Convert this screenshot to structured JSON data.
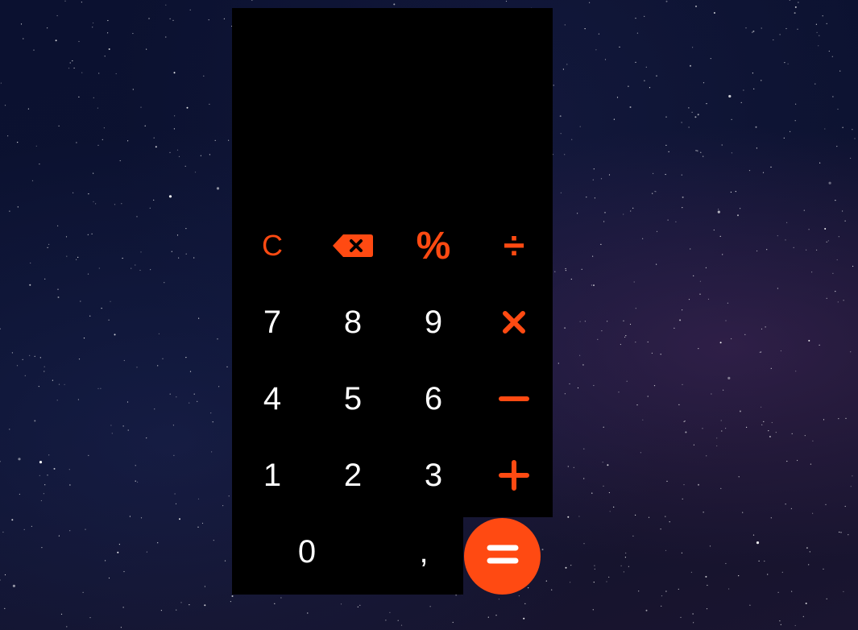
{
  "colors": {
    "accent": "#ff4a12",
    "digit": "#ffffff",
    "panel": "#000000"
  },
  "display": {
    "value": ""
  },
  "keys": {
    "clear": "C",
    "backspace_icon": "backspace-icon",
    "percent": "%",
    "divide": "÷",
    "seven": "7",
    "eight": "8",
    "nine": "9",
    "multiply_icon": "multiply-icon",
    "four": "4",
    "five": "5",
    "six": "6",
    "minus_icon": "minus-icon",
    "one": "1",
    "two": "2",
    "three": "3",
    "plus_icon": "plus-icon",
    "zero": "0",
    "comma": ",",
    "equals_icon": "equals-icon"
  }
}
